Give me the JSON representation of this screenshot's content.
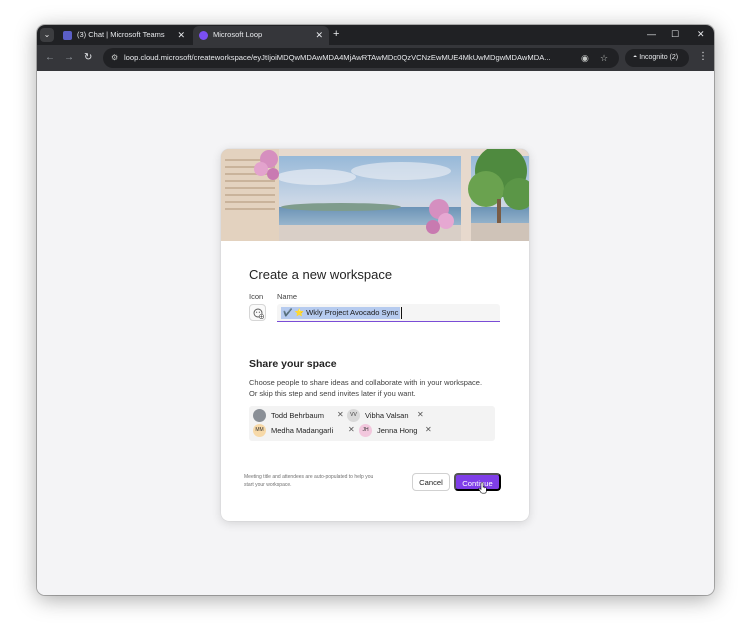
{
  "browser": {
    "tabs": [
      {
        "title": "(3) Chat | Microsoft Teams",
        "active": false,
        "favicon_color": "#5b5fc7"
      },
      {
        "title": "Microsoft Loop",
        "active": true,
        "favicon_color": "#7b4ff2"
      }
    ],
    "new_tab": "+",
    "tab_close": "✕",
    "address": "loop.cloud.microsoft/createworkspace/eyJtIjoiMDQwMDAwMDA4MjAwRTAwMDc0QzVCNzEwMUE4MkUwMDgwMDAwMDA...",
    "incognito_label": "Incognito (2)",
    "window_controls": {
      "minimize": "—",
      "maximize": "☐",
      "close": "✕"
    }
  },
  "dialog": {
    "title": "Create a new workspace",
    "icon_label": "Icon",
    "name_label": "Name",
    "name_value": "✔️ ⭐ Wkly Project Avocado Sync",
    "share_title": "Share your space",
    "share_desc_1": "Choose people to share ideas and collaborate with in your workspace.",
    "share_desc_2": "Or skip this step and send invites later if you want.",
    "people": [
      {
        "name": "Todd Behrbaum",
        "initials": "",
        "avatar_color": "#8a8f96"
      },
      {
        "name": "Vibha Valsan",
        "initials": "VV",
        "avatar_color": "#d9d9d9"
      },
      {
        "name": "Medha Madangarli",
        "initials": "MM",
        "avatar_color": "#f7d9a8"
      },
      {
        "name": "Jenna Hong",
        "initials": "JH",
        "avatar_color": "#f2c7dd"
      }
    ],
    "remove_glyph": "✕",
    "footnote": "Meeting title and attendees are auto-populated to help you start your workspace.",
    "cancel_label": "Cancel",
    "continue_label": "Continue",
    "accent_color": "#7f3ee8"
  }
}
